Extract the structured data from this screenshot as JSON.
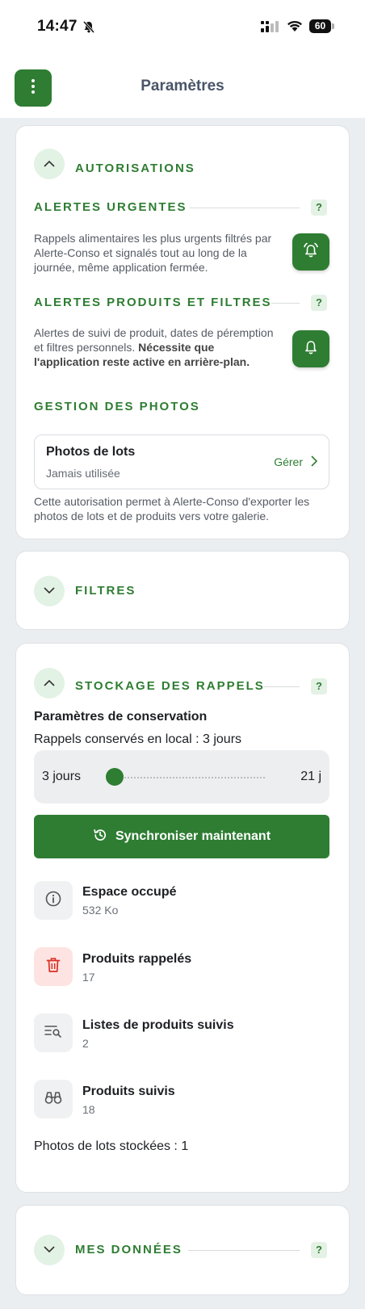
{
  "status_bar": {
    "time": "14:47",
    "battery": "60"
  },
  "header": {
    "title": "Paramètres"
  },
  "authorizations": {
    "title": "AUTORISATIONS",
    "urgent": {
      "title": "ALERTES URGENTES",
      "help": "?",
      "description": "Rappels alimentaires les plus urgents filtrés par Alerte-Conso et signalés tout au long de la journée, même application fermée."
    },
    "products": {
      "title": "ALERTES PRODUITS ET FILTRES",
      "help": "?",
      "description_plain": "Alertes de suivi de produit, dates de péremption et filtres personnels. ",
      "description_bold": "Nécessite que l'application reste active en arrière-plan."
    },
    "photos": {
      "title": "GESTION DES PHOTOS",
      "box_title": "Photos de lots",
      "box_status": "Jamais utilisée",
      "manage_label": "Gérer",
      "description": "Cette autorisation permet à Alerte-Conso d'exporter les photos de lots et de produits vers votre galerie."
    }
  },
  "filters": {
    "title": "FILTRES"
  },
  "storage": {
    "title": "STOCKAGE DES RAPPELS",
    "help": "?",
    "conservation_title": "Paramètres de conservation",
    "conservation_text": "Rappels conservés en local : 3 jours",
    "slider": {
      "min_label": "3 jours",
      "max_label": "21 j",
      "value_fraction": 0.0
    },
    "sync_label": "Synchroniser maintenant",
    "stats": [
      {
        "name": "Espace occupé",
        "value": "532 Ko",
        "icon": "info-icon"
      },
      {
        "name": "Produits rappelés",
        "value": "17",
        "icon": "trash-icon"
      },
      {
        "name": "Listes de produits suivis",
        "value": "2",
        "icon": "list-search-icon"
      },
      {
        "name": "Produits suivis",
        "value": "18",
        "icon": "binoculars-icon"
      }
    ],
    "photos_stored": "Photos de lots stockées : 1"
  },
  "my_data": {
    "title": "MES DONNÉES",
    "help": "?"
  },
  "colors": {
    "primary": "#2e7d32",
    "primary_light": "#e2f2e4",
    "danger_bg": "#fde3e1",
    "danger": "#d93025"
  }
}
